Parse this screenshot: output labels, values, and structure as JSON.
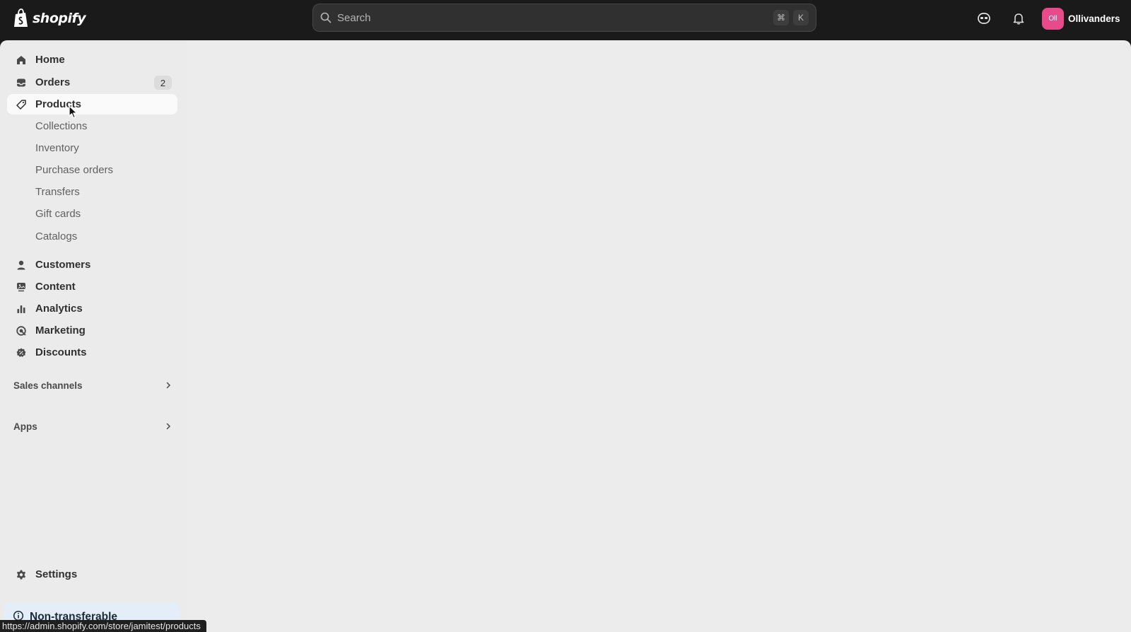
{
  "header": {
    "brand": "shopify",
    "search_placeholder": "Search",
    "shortcut_keys": [
      "⌘",
      "K"
    ],
    "account_initials": "Oll",
    "account_name": "Ollivanders"
  },
  "sidebar": {
    "items": [
      {
        "label": "Home",
        "icon": "home-icon"
      },
      {
        "label": "Orders",
        "icon": "orders-icon",
        "badge": "2"
      },
      {
        "label": "Products",
        "icon": "tag-icon",
        "active": true
      },
      {
        "label": "Customers",
        "icon": "person-icon"
      },
      {
        "label": "Content",
        "icon": "content-icon"
      },
      {
        "label": "Analytics",
        "icon": "bar-chart-icon"
      },
      {
        "label": "Marketing",
        "icon": "target-icon"
      },
      {
        "label": "Discounts",
        "icon": "discount-icon"
      }
    ],
    "products_sub": [
      "Collections",
      "Inventory",
      "Purchase orders",
      "Transfers",
      "Gift cards",
      "Catalogs"
    ],
    "sections": [
      {
        "label": "Sales channels"
      },
      {
        "label": "Apps"
      }
    ],
    "settings_label": "Settings",
    "notice_label": "Non-transferable"
  },
  "status_bar": {
    "url": "https://admin.shopify.com/store/jamitest/products"
  },
  "colors": {
    "topbar": "#1a1a1a",
    "sidebar": "#ebebeb",
    "main": "#ececec",
    "avatar": "#e84a8a",
    "notice": "#e3eef9"
  }
}
